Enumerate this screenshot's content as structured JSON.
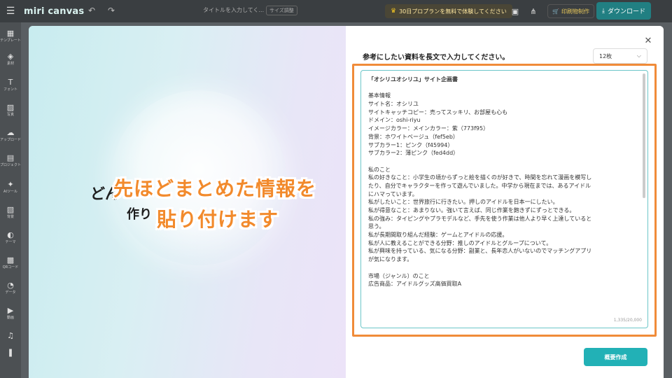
{
  "topbar": {
    "logo": "miri canvas",
    "title_placeholder": "タイトルを入力してく...",
    "save_state": "サイズ調整",
    "promo": "30日プロプランを無料で体験してください",
    "make_label": "印刷物制作",
    "download_label": "ダウンロード"
  },
  "sidebar": {
    "items": [
      {
        "icon": "template-icon",
        "label": "テンプレート"
      },
      {
        "icon": "elements-icon",
        "label": "素材"
      },
      {
        "icon": "text-icon",
        "label": "フォント"
      },
      {
        "icon": "photo-icon",
        "label": "写真"
      },
      {
        "icon": "upload-icon",
        "label": "アップロード"
      },
      {
        "icon": "project-icon",
        "label": "プロジェクト"
      },
      {
        "icon": "ai-tool-icon",
        "label": "AIツール"
      },
      {
        "icon": "background-icon",
        "label": "背景"
      },
      {
        "icon": "theme-icon",
        "label": "テーマ"
      },
      {
        "icon": "qr-icon",
        "label": "QRコード"
      },
      {
        "icon": "data-icon",
        "label": "データ"
      },
      {
        "icon": "video-icon",
        "label": "動画"
      },
      {
        "icon": "music-icon",
        "label": ""
      },
      {
        "icon": "book-icon",
        "label": ""
      }
    ]
  },
  "hero": {
    "line1": "どん",
    "line2": "作り"
  },
  "form": {
    "prompt_label": "参考にしたい資料を長文で入力してください。",
    "count_value": "12枚",
    "textarea_lines": [
      "「オシリユオシリユ」サイト企画書",
      "",
      "基本情報",
      "サイト名：オシリユ",
      "サイトキャッチコピー：売ってスッキリ、お部屋も心も",
      "ドメイン：oshi-riyu",
      "イメージカラー：メインカラー：紫（773f95）",
      "背景：ホワイトベージュ（fef5eb）",
      "サブカラー1：ピンク（f45994）",
      "サブカラー2：薄ピンク（fed4dd）",
      "",
      "私のこと",
      "私の好きなこと：小学生の頃からずっと絵を描くのが好きで、時間を忘れて漫画を模写し",
      "たり、自分でキャラクターを作って遊んでいました。中学から現在までは、あるアイドル",
      "にハマっています。",
      "私がしたいこと：世界旅行に行きたい。押しのアイドルを日本一にしたい。",
      "私が得意なこと：あまりない。強いて言えば、同じ作業を飽きずにずっとできる。",
      "私の強み：タイピングやプラモデルなど、手先を使う作業は他人より早く上達していると",
      "思う。",
      "私が長期間取り組んだ経験：ゲームとアイドルの応援。",
      "私が人に教えることができる分野：推しのアイドルとグループについて。",
      "私が興味を持っている、気になる分野：副業と、長年恋人がいないのでマッチングアプリ",
      "が気になります。",
      "",
      "市場（ジャンル）のこと",
      "広告商品：アイドルグッズ高価買取A"
    ],
    "char_count": "1,335/20,000",
    "submit_label": "概要作成"
  },
  "annotation": {
    "caption_line1": "先ほどまとめた情報を",
    "caption_line2": "貼り付けます",
    "color": "#f28a2c"
  }
}
